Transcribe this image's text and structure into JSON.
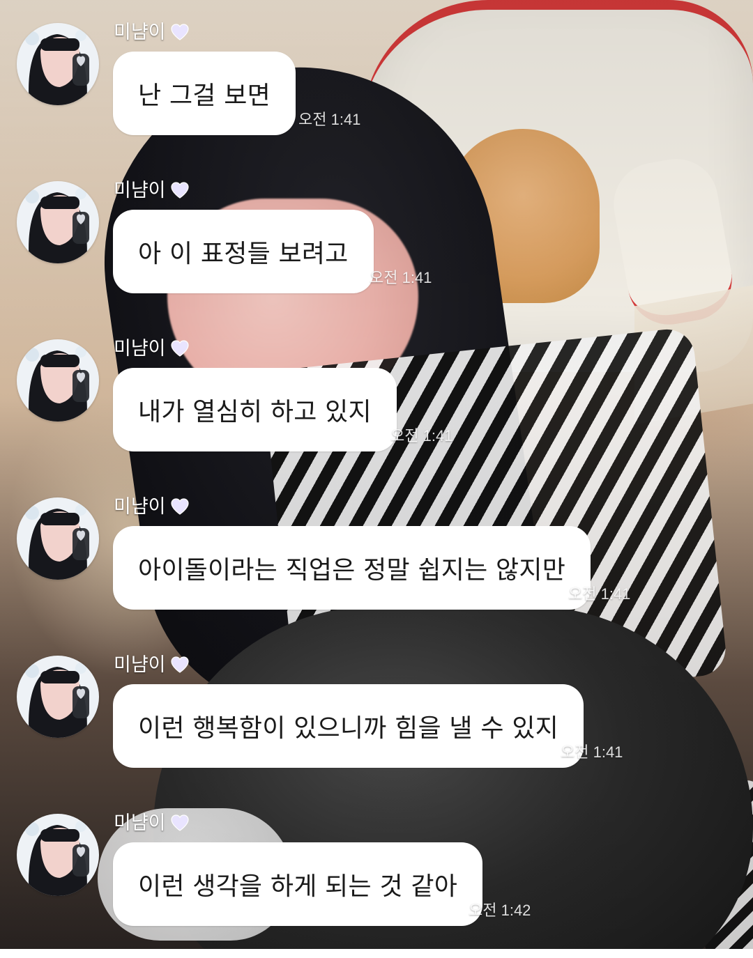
{
  "messages": [
    {
      "sender": "미냠이",
      "text": "난 그걸 보면",
      "time": "오전 1:41"
    },
    {
      "sender": "미냠이",
      "text": "아 이 표정들 보려고",
      "time": "오전 1:41"
    },
    {
      "sender": "미냠이",
      "text": "내가 열심히 하고 있지",
      "time": "오전 1:41"
    },
    {
      "sender": "미냠이",
      "text": "아이돌이라는 직업은 정말 쉽지는 않지만",
      "time": "오전 1:41"
    },
    {
      "sender": "미냠이",
      "text": "이런 행복함이 있으니까 힘을 낼 수 있지",
      "time": "오전 1:41"
    },
    {
      "sender": "미냠이",
      "text": "이런 생각을 하게 되는 것 같아",
      "time": "오전 1:42"
    }
  ],
  "icons": {
    "heart": "heart-icon",
    "avatar": "profile-avatar"
  },
  "colors": {
    "bubble": "#ffffff",
    "heart": "#e9e4ff"
  }
}
